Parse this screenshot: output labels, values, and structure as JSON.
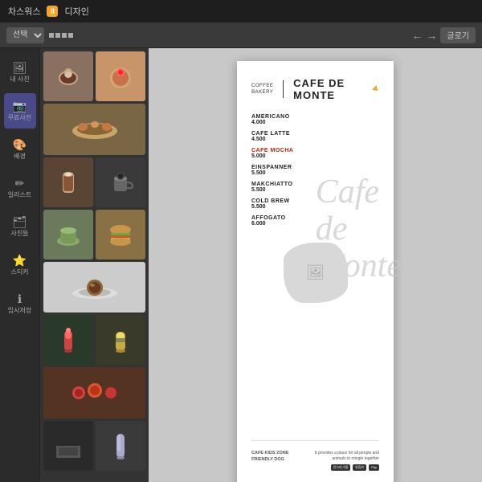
{
  "app": {
    "title": "차스워스",
    "subtitle": "디자인",
    "icon_label": "8"
  },
  "toolbar": {
    "select_label": "선택",
    "zoom_label": "글로기",
    "undo_arrow": "←",
    "redo_arrow": "→"
  },
  "sidebar": {
    "items": [
      {
        "label": "내 사진",
        "icon": "🖼"
      },
      {
        "label": "무료사진",
        "icon": "📷",
        "active": true
      },
      {
        "label": "배경",
        "icon": "🎨"
      },
      {
        "label": "일러스트",
        "icon": "✏"
      },
      {
        "label": "사진들",
        "icon": "🗂"
      },
      {
        "label": "스티커",
        "icon": "⭐"
      },
      {
        "label": "임시저장",
        "icon": "①"
      }
    ]
  },
  "design": {
    "cafe_line1": "COFFEE",
    "cafe_line2": "BAKERY",
    "cafe_name": "CAFE DE MONTE",
    "menu_items": [
      {
        "name": "AMERICANO",
        "price": "4.000"
      },
      {
        "name": "CAFE LATTE",
        "price": "4.500"
      },
      {
        "name": "CAFE MOCHA",
        "price": "5.000",
        "highlight": true
      },
      {
        "name": "EINSPANNER",
        "price": "5.500"
      },
      {
        "name": "MAKCHIATTO",
        "price": "5.500"
      },
      {
        "name": "COLD BREW",
        "price": "5.500"
      },
      {
        "name": "AFFOGATO",
        "price": "6.000"
      }
    ],
    "script_text_line1": "Cafe",
    "script_text_line2": "de",
    "script_text_line3": "Monte",
    "footer_left_1": "CAFE KIDS ZONE",
    "footer_left_2": "FRIENDLY DOG",
    "footer_right": "It provides a place for all people and animals to mingle together",
    "footer_badge_1": "인스타그램",
    "footer_badge_2": "유튜브",
    "footer_badge_3": "Pay"
  }
}
